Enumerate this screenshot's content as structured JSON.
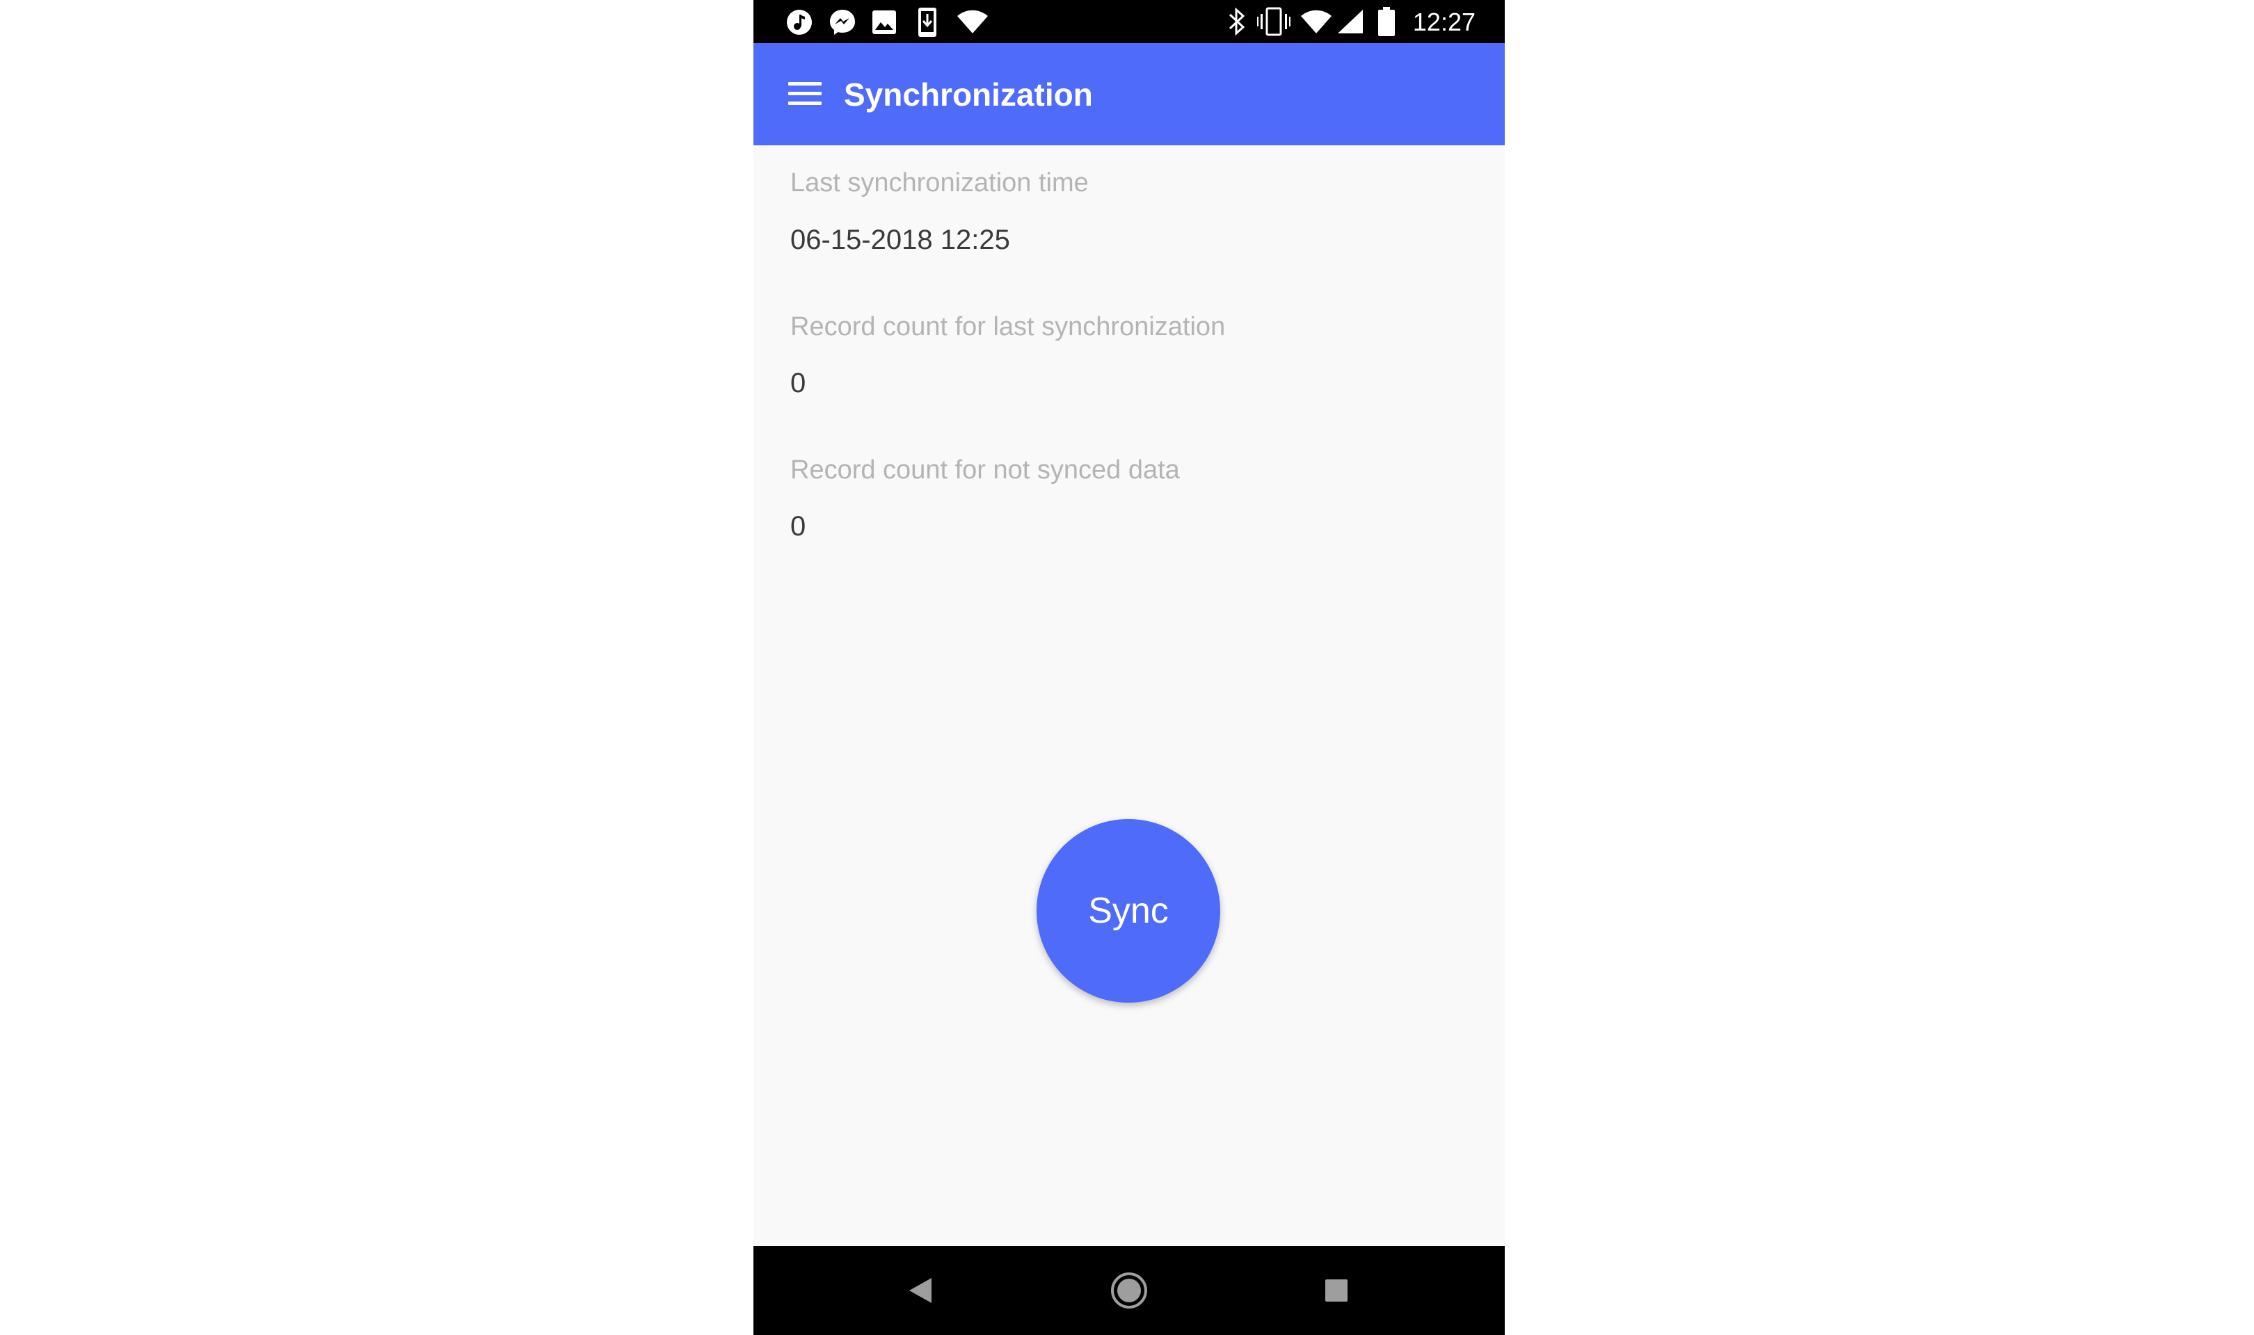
{
  "status_bar": {
    "time": "12:27",
    "left_icons": [
      "music-note-icon",
      "messenger-icon",
      "image-icon",
      "download-icon",
      "wifi-icon"
    ],
    "right_icons": [
      "bluetooth-icon",
      "vibrate-icon",
      "wifi-icon",
      "cell-signal-icon",
      "battery-icon"
    ]
  },
  "app_bar": {
    "title": "Synchronization",
    "menu_icon": "hamburger-menu-icon",
    "color": "#4f6bfa"
  },
  "fields": {
    "last_sync_time": {
      "label": "Last synchronization time",
      "value": "06-15-2018 12:25"
    },
    "last_sync_count": {
      "label": "Record count for last synchronization",
      "value": "0"
    },
    "not_synced_count": {
      "label": "Record count for not synced data",
      "value": "0"
    }
  },
  "sync_button": {
    "label": "Sync",
    "color": "#4f6bfa"
  },
  "nav_bar": {
    "icons": [
      "back-icon",
      "home-icon",
      "recents-icon"
    ]
  }
}
